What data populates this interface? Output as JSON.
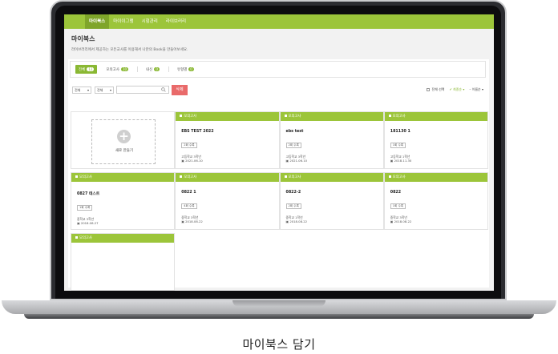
{
  "nav": [
    "마이북스",
    "마이이그램",
    "시험관리",
    "라이브러리"
  ],
  "page": {
    "title": "마이북스",
    "description": "라이브러리에서 제공하는 모든교사를 이용해서 나만의 Book을 만들어보세요."
  },
  "tabs": [
    {
      "label": "전체",
      "count": "12"
    },
    {
      "label": "모의고사",
      "count": "10"
    },
    {
      "label": "내신",
      "count": "0"
    },
    {
      "label": "유형별",
      "count": "0"
    }
  ],
  "filters": {
    "select1": "전체",
    "select2": "전체",
    "delete_label": "삭제",
    "select_all": "전체 선택",
    "sort_recent": "최종순",
    "sort_name": "이름순"
  },
  "new_card_label": "새로 만들기",
  "cards": [
    {
      "category": "모의고사",
      "title": "EBS TEST 2022",
      "badge": "2회 수록",
      "school": "고등학교 3학년",
      "date": "2021.06.10"
    },
    {
      "category": "모의고사",
      "title": "ebs test",
      "badge": "2회 수록",
      "school": "고등학교 3학년",
      "date": "2021.06.10"
    },
    {
      "category": "모의고사",
      "title": "181130 1",
      "badge": "1회 수록",
      "school": "고등학교 1학년",
      "date": "2018.11.30"
    },
    {
      "category": "모의고사",
      "title": "0827 테스트",
      "badge": "1회 수록",
      "school": "중학교 3학년",
      "date": "2018.08.27"
    },
    {
      "category": "모의고사",
      "title": "0822 1",
      "badge": "4회 수록",
      "school": "중학교 3학년",
      "date": "2018.08.22"
    },
    {
      "category": "모의고사",
      "title": "0822-2",
      "badge": "2회 수록",
      "school": "중학교 1학년",
      "date": "2018.08.22"
    },
    {
      "category": "모의고사",
      "title": "0822",
      "badge": "1회 수록",
      "school": "중학교 3학년",
      "date": "2018.08.22"
    },
    {
      "category": "모의고사",
      "title": "",
      "badge": "",
      "school": "",
      "date": ""
    }
  ],
  "caption": "마이북스 담기"
}
